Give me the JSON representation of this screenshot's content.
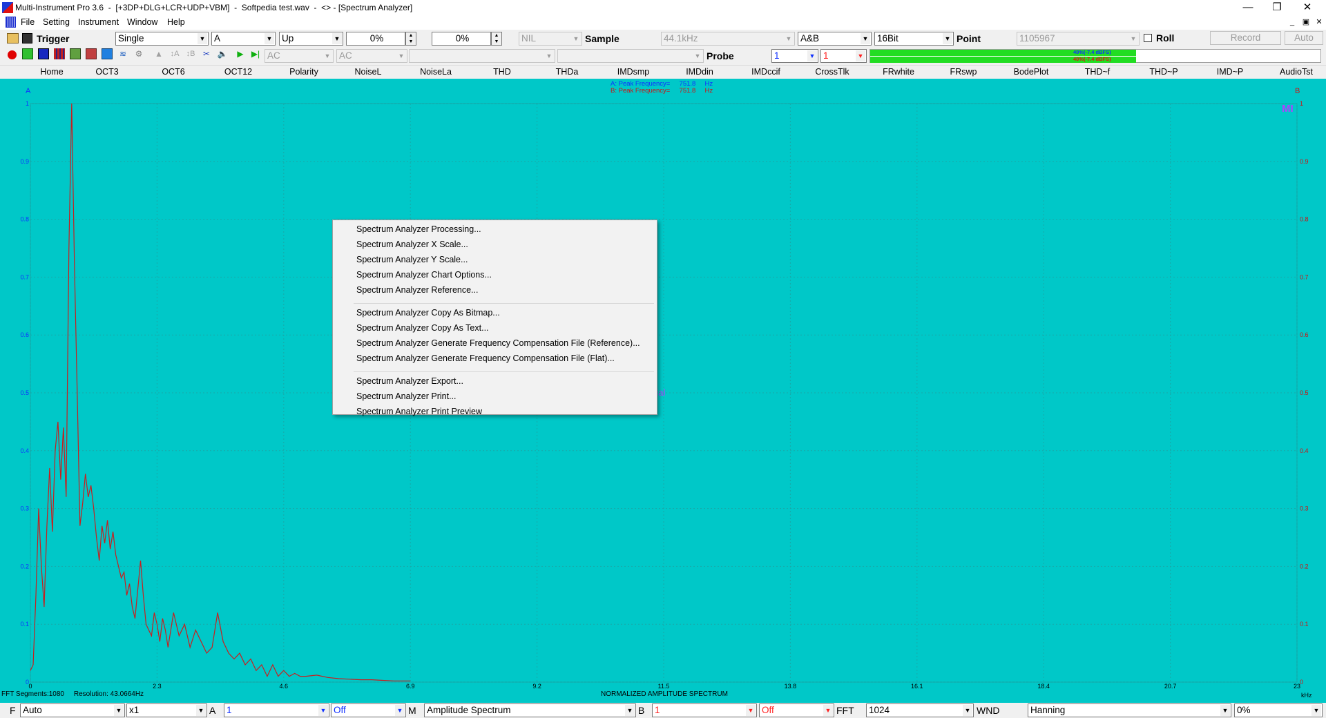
{
  "window": {
    "title": "Multi-Instrument Pro 3.6  -  [+3DP+DLG+LCR+UDP+VBM]  -  Softpedia test.wav  -  <> - [Spectrum Analyzer]",
    "controls": [
      "—",
      "❐",
      "✕"
    ]
  },
  "menu": {
    "items": [
      "File",
      "Setting",
      "Instrument",
      "Window",
      "Help"
    ],
    "mdi_controls": [
      "_",
      "▣",
      "✕"
    ]
  },
  "toolbar1": {
    "trigger_label": "Trigger",
    "trigger_mode": "Single",
    "trigger_channel": "A",
    "trigger_edge": "Up",
    "trigger_level": "0%",
    "trigger_delay": "0%",
    "nil_value": "NIL",
    "sample_label": "Sample",
    "sample_rate": "44.1kHz",
    "channels": "A&B",
    "bit_depth": "16Bit",
    "point_label": "Point",
    "point_value": "1105967",
    "roll_label": "Roll",
    "record_label": "Record",
    "auto_label": "Auto"
  },
  "toolbar2": {
    "coupling_a": "AC",
    "coupling_b": "AC",
    "probe_label": "Probe",
    "probe_a": "1",
    "probe_b": "1",
    "level_a": "40%(-7.4 dBFS)",
    "level_b": "40%(-7.4 dBFS)",
    "level_fraction": 0.59
  },
  "tabs": [
    "Home",
    "OCT3",
    "OCT6",
    "OCT12",
    "Polarity",
    "NoiseL",
    "NoiseLa",
    "THD",
    "THDa",
    "IMDsmp",
    "IMDdin",
    "IMDccif",
    "CrossTlk",
    "FRwhite",
    "FRswp",
    "BodePlot",
    "THD~f",
    "THD~P",
    "IMD~P",
    "AudioTst"
  ],
  "chart": {
    "channel_a_label": "A",
    "channel_b_label": "B",
    "peak_a": "A: Peak Frequency=     751.8     Hz",
    "peak_b": "B: Peak Frequency=     751.8     Hz",
    "watermark": "MI",
    "trial_text": "rial",
    "footer_center": "NORMALIZED AMPLITUDE SPECTRUM",
    "footer_left": "FFT Segments:1080     Resolution: 43.0664Hz",
    "x_unit": "kHz",
    "colors": {
      "background": "#00c8c8",
      "trace": "#c81e1e",
      "left_axis_text": "#1030ff",
      "right_axis_text": "#d01010"
    }
  },
  "chart_data": {
    "type": "line",
    "title": "",
    "xlabel": "kHz",
    "ylabel": "",
    "xlim": [
      0,
      23
    ],
    "ylim": [
      0,
      1
    ],
    "x_ticks": [
      "0",
      "2.3",
      "4.6",
      "6.9",
      "9.2",
      "11.5",
      "13.8",
      "16.1",
      "18.4",
      "20.7",
      "23"
    ],
    "y_ticks": [
      "0",
      "0.1",
      "0.2",
      "0.3",
      "0.4",
      "0.5",
      "0.6",
      "0.7",
      "0.8",
      "0.9",
      "1"
    ],
    "series": [
      {
        "x": [
          0,
          0.05,
          0.1,
          0.15,
          0.2,
          0.25,
          0.3,
          0.35,
          0.4,
          0.45,
          0.5,
          0.55,
          0.6,
          0.65,
          0.7,
          0.75,
          0.8,
          0.85,
          0.9,
          0.95,
          1.0,
          1.05,
          1.1,
          1.15,
          1.2,
          1.25,
          1.3,
          1.35,
          1.4,
          1.45,
          1.5,
          1.55,
          1.6,
          1.65,
          1.7,
          1.75,
          1.8,
          1.85,
          1.9,
          1.95,
          2.0,
          2.05,
          2.1,
          2.15,
          2.2,
          2.25,
          2.3,
          2.35,
          2.4,
          2.45,
          2.5,
          2.6,
          2.7,
          2.8,
          2.9,
          3.0,
          3.1,
          3.2,
          3.3,
          3.4,
          3.5,
          3.6,
          3.7,
          3.8,
          3.9,
          4.0,
          4.1,
          4.2,
          4.3,
          4.4,
          4.5,
          4.6,
          4.7,
          4.8,
          4.9,
          5.0,
          5.2,
          5.4,
          5.6,
          5.8,
          6.0,
          6.2,
          6.4,
          6.6,
          6.9
        ],
        "values": [
          0.02,
          0.03,
          0.15,
          0.3,
          0.2,
          0.13,
          0.27,
          0.37,
          0.26,
          0.4,
          0.45,
          0.35,
          0.44,
          0.32,
          0.75,
          1.0,
          0.72,
          0.5,
          0.27,
          0.31,
          0.36,
          0.32,
          0.34,
          0.3,
          0.25,
          0.21,
          0.27,
          0.24,
          0.28,
          0.23,
          0.26,
          0.22,
          0.2,
          0.18,
          0.19,
          0.15,
          0.17,
          0.13,
          0.11,
          0.16,
          0.21,
          0.15,
          0.1,
          0.09,
          0.08,
          0.12,
          0.1,
          0.07,
          0.11,
          0.09,
          0.06,
          0.12,
          0.08,
          0.1,
          0.06,
          0.09,
          0.07,
          0.05,
          0.06,
          0.12,
          0.07,
          0.05,
          0.04,
          0.05,
          0.03,
          0.04,
          0.02,
          0.03,
          0.01,
          0.03,
          0.01,
          0.02,
          0.01,
          0.015,
          0.01,
          0.01,
          0.012,
          0.008,
          0.006,
          0.005,
          0.004,
          0.004,
          0.003,
          0.002,
          0.002
        ]
      }
    ]
  },
  "context_menu": {
    "groups": [
      [
        "Spectrum Analyzer Processing...",
        "Spectrum Analyzer X Scale...",
        "Spectrum Analyzer Y Scale...",
        "Spectrum Analyzer Chart Options...",
        "Spectrum Analyzer Reference..."
      ],
      [
        "Spectrum Analyzer Copy As Bitmap...",
        "Spectrum Analyzer Copy As Text...",
        "Spectrum Analyzer Generate Frequency Compensation File (Reference)...",
        "Spectrum Analyzer Generate Frequency Compensation File (Flat)..."
      ],
      [
        "Spectrum Analyzer Export...",
        "Spectrum Analyzer Print...",
        "Spectrum Analyzer Print Preview"
      ]
    ]
  },
  "bottombar": {
    "f_label": "F",
    "f_mode": "Auto",
    "zoom": "x1",
    "a_label": "A",
    "a_value": "1",
    "a_state": "Off",
    "m_label": "M",
    "mode": "Amplitude Spectrum",
    "b_label": "B",
    "b_value": "1",
    "b_state": "Off",
    "fft_label": "FFT",
    "fft_size": "1024",
    "wnd_label": "WND",
    "window_fn": "Hanning",
    "overlap": "0%"
  }
}
